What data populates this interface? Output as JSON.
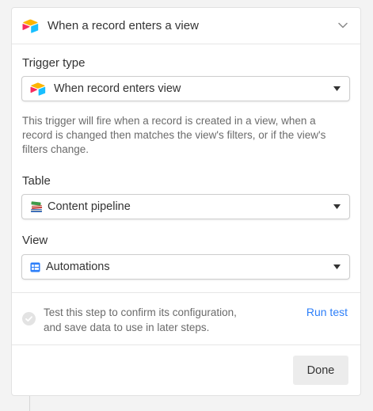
{
  "header": {
    "title": "When a record enters a view",
    "icon": "airtable-logo-icon",
    "collapse_icon": "chevron-down-icon"
  },
  "trigger_type": {
    "label": "Trigger type",
    "selected": "When record enters view",
    "icon": "airtable-logo-icon",
    "description": "This trigger will fire when a record is created in a view, when a record is changed then matches the view's filters, or if the view's filters change."
  },
  "table": {
    "label": "Table",
    "selected": "Content pipeline",
    "icon": "books-emoji-icon"
  },
  "view": {
    "label": "View",
    "selected": "Automations",
    "icon": "grid-view-icon"
  },
  "test": {
    "line1": "Test this step to confirm its configuration,",
    "line2": "and save data to use in later steps.",
    "run_label": "Run test",
    "icon": "check-circle-icon"
  },
  "footer": {
    "done_label": "Done"
  },
  "colors": {
    "link": "#2d7ff9",
    "muted_text": "#6b6b6b",
    "button_bg": "#ececec"
  }
}
